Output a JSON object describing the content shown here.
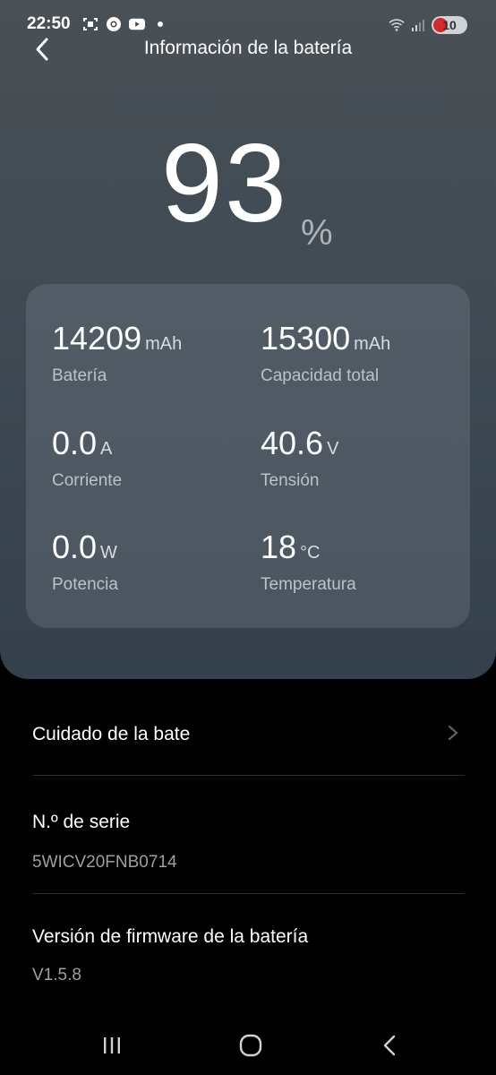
{
  "status_bar": {
    "time": "22:50",
    "battery_level": "10",
    "left_icons": [
      "screenshot-icon",
      "chrome-icon",
      "youtube-icon",
      "dot-icon"
    ],
    "right_icons": [
      "wifi-icon",
      "signal-icon",
      "battery-saver-icon"
    ]
  },
  "header": {
    "title": "Información de la batería"
  },
  "battery": {
    "percent": "93",
    "percent_sign": "%"
  },
  "stats": [
    {
      "value": "14209",
      "unit": "mAh",
      "label": "Batería"
    },
    {
      "value": "15300",
      "unit": "mAh",
      "label": "Capacidad total"
    },
    {
      "value": "0.0",
      "unit": "A",
      "label": "Corriente"
    },
    {
      "value": "40.6",
      "unit": "V",
      "label": "Tensión"
    },
    {
      "value": "0.0",
      "unit": "W",
      "label": "Potencia"
    },
    {
      "value": "18",
      "unit": "°C",
      "label": "Temperatura"
    }
  ],
  "list": {
    "care_title": "Cuidado de la bate",
    "serial_title": "N.º de serie",
    "serial_value": "5WICV20FNB0714",
    "firmware_title": "Versión de firmware de la batería",
    "firmware_value": "V1.5.8"
  },
  "navbar": [
    "recents-icon",
    "home-icon",
    "back-icon"
  ],
  "colors": {
    "hero_top": "#4a5055",
    "hero_bottom": "#34404b",
    "background": "#000000",
    "battery_alert": "#d62a2a"
  }
}
